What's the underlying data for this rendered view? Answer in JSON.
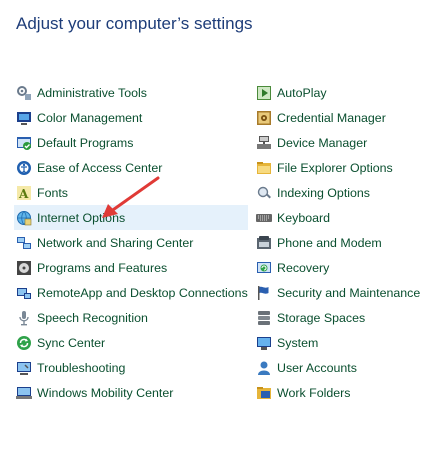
{
  "page": {
    "title": "Adjust your computer’s settings"
  },
  "left_items": [
    {
      "label": "Administrative Tools",
      "icon": "administrative-tools-icon",
      "hovered": false
    },
    {
      "label": "Color Management",
      "icon": "color-management-icon",
      "hovered": false
    },
    {
      "label": "Default Programs",
      "icon": "default-programs-icon",
      "hovered": false
    },
    {
      "label": "Ease of Access Center",
      "icon": "ease-of-access-icon",
      "hovered": false
    },
    {
      "label": "Fonts",
      "icon": "fonts-icon",
      "hovered": false
    },
    {
      "label": "Internet Options",
      "icon": "internet-options-icon",
      "hovered": true
    },
    {
      "label": "Network and Sharing Center",
      "icon": "network-sharing-icon",
      "hovered": false
    },
    {
      "label": "Programs and Features",
      "icon": "programs-features-icon",
      "hovered": false
    },
    {
      "label": "RemoteApp and Desktop Connections",
      "icon": "remoteapp-icon",
      "hovered": false
    },
    {
      "label": "Speech Recognition",
      "icon": "microphone-icon",
      "hovered": false
    },
    {
      "label": "Sync Center",
      "icon": "sync-center-icon",
      "hovered": false
    },
    {
      "label": "Troubleshooting",
      "icon": "troubleshooting-icon",
      "hovered": false
    },
    {
      "label": "Windows Mobility Center",
      "icon": "mobility-center-icon",
      "hovered": false
    }
  ],
  "right_items": [
    {
      "label": "AutoPlay",
      "icon": "autoplay-icon"
    },
    {
      "label": "Credential Manager",
      "icon": "credential-manager-icon"
    },
    {
      "label": "Device Manager",
      "icon": "device-manager-icon"
    },
    {
      "label": "File Explorer Options",
      "icon": "file-explorer-options-icon"
    },
    {
      "label": "Indexing Options",
      "icon": "indexing-options-icon"
    },
    {
      "label": "Keyboard",
      "icon": "keyboard-icon"
    },
    {
      "label": "Phone and Modem",
      "icon": "phone-modem-icon"
    },
    {
      "label": "Recovery",
      "icon": "recovery-icon"
    },
    {
      "label": "Security and Maintenance",
      "icon": "security-flag-icon"
    },
    {
      "label": "Storage Spaces",
      "icon": "storage-spaces-icon"
    },
    {
      "label": "System",
      "icon": "system-icon"
    },
    {
      "label": "User Accounts",
      "icon": "user-accounts-icon"
    },
    {
      "label": "Work Folders",
      "icon": "work-folders-icon"
    }
  ],
  "colors": {
    "title": "#1e3d79",
    "link": "#0a4f2f",
    "hover_bg": "#e5f1fb",
    "annotation_arrow": "#e03a36"
  }
}
